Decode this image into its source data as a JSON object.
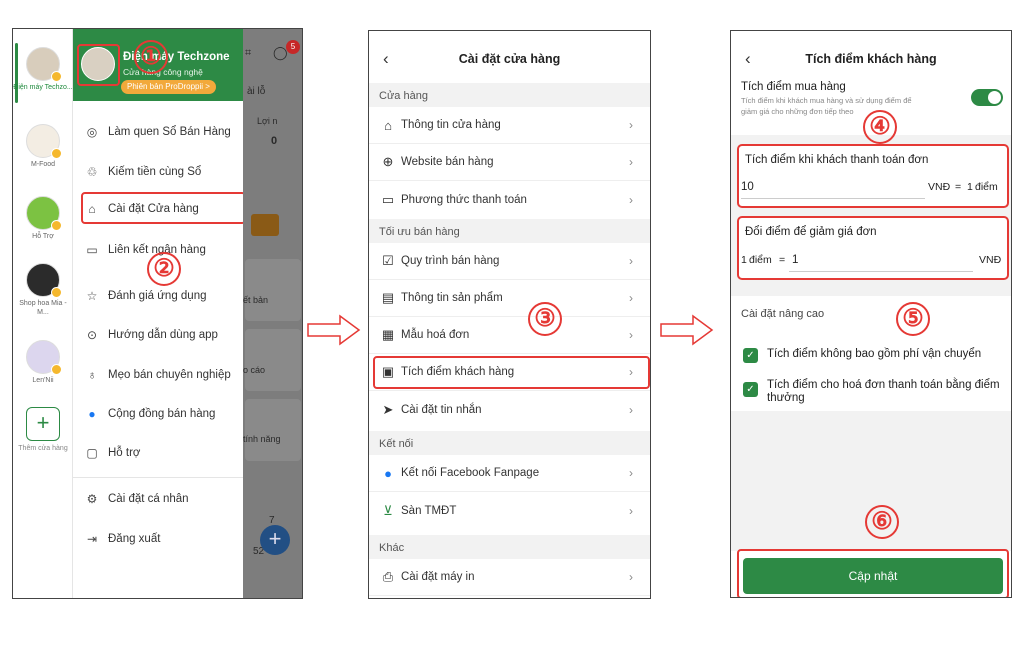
{
  "panel1": {
    "stores": [
      {
        "label": "Điện máy Techzo..."
      },
      {
        "label": "M-Food"
      },
      {
        "label": "Hỗ Trợ"
      },
      {
        "label": "Shop hoa Mia - M..."
      },
      {
        "label": "Len'Nii"
      }
    ],
    "add_store_label": "Thêm cửa hàng",
    "store_name": "Điện máy Techzone",
    "store_type": "Cửa hàng công nghệ",
    "version_badge": "Phiên bản ProDroppii >",
    "menu_items": [
      {
        "label": "Làm quen Sổ Bán Hàng",
        "icon": "target-icon"
      },
      {
        "label": "Kiếm tiền cùng Sổ",
        "icon": "handshake-icon"
      },
      {
        "label": "Cài đặt Cửa hàng",
        "icon": "store-icon"
      },
      {
        "label": "Liên kết ngân hàng",
        "icon": "card-icon"
      },
      {
        "label": "Đánh giá ứng dụng",
        "icon": "star-icon"
      },
      {
        "label": "Hướng dẫn dùng app",
        "icon": "play-icon"
      },
      {
        "label": "Mẹo bán chuyên nghiệp",
        "icon": "bulb-icon"
      },
      {
        "label": "Cộng đồng bán hàng",
        "icon": "facebook-icon"
      },
      {
        "label": "Hỗ trợ",
        "icon": "chat-icon"
      },
      {
        "label": "Cài đặt cá nhân",
        "icon": "gear-icon"
      },
      {
        "label": "Đăng xuất",
        "icon": "logout-icon"
      }
    ],
    "background": {
      "badge": "5",
      "tab_fragment": "ài lỗ",
      "loi_fragment": "Lợi n",
      "zero": "0",
      "tile1": "ết bản",
      "tile2": "o cáo",
      "tile3": "tính năng",
      "num1": "7",
      "num2": "52"
    }
  },
  "panel2": {
    "title": "Cài đặt cửa hàng",
    "sections": [
      {
        "header": "Cửa hàng",
        "items": [
          {
            "label": "Thông tin cửa hàng",
            "icon": "store-icon"
          },
          {
            "label": "Website bán hàng",
            "icon": "globe-icon"
          },
          {
            "label": "Phương thức thanh toán",
            "icon": "card-icon"
          }
        ]
      },
      {
        "header": "Tối ưu bán hàng",
        "items": [
          {
            "label": "Quy trình bán hàng",
            "icon": "checklist-icon"
          },
          {
            "label": "Thông tin sản phẩm",
            "icon": "box-icon"
          },
          {
            "label": "Mẫu hoá đơn",
            "icon": "receipt-icon"
          },
          {
            "label": "Tích điểm khách hàng",
            "icon": "points-icon"
          },
          {
            "label": "Cài đặt tin nhắn",
            "icon": "send-icon"
          }
        ]
      },
      {
        "header": "Kết nối",
        "items": [
          {
            "label": "Kết nối Facebook Fanpage",
            "icon": "facebook-icon"
          },
          {
            "label": "Sàn TMĐT",
            "icon": "cart-icon"
          }
        ]
      },
      {
        "header": "Khác",
        "items": [
          {
            "label": "Cài đặt máy in",
            "icon": "printer-icon"
          }
        ]
      }
    ]
  },
  "panel3": {
    "title": "Tích điểm khách hàng",
    "toggle_title": "Tích điểm mua hàng",
    "toggle_desc": "Tích điểm khi khách mua hàng và sử dụng điểm để giảm giá cho những đơn tiếp theo",
    "toggle_on": true,
    "earn": {
      "title": "Tích điểm khi khách thanh toán đơn",
      "amount": "10",
      "currency": "VNĐ",
      "equals": "=",
      "points_num": "1",
      "points_word": "điểm"
    },
    "redeem": {
      "title": "Đổi điểm để giảm giá đơn",
      "points_num": "1",
      "points_word": "điểm",
      "equals": "=",
      "amount": "1",
      "currency": "VNĐ"
    },
    "advanced_title": "Cài đặt nâng cao",
    "checkboxes": [
      {
        "label": "Tích điểm không bao gồm phí vận chuyển",
        "checked": true
      },
      {
        "label": "Tích điểm cho hoá đơn thanh toán bằng điểm thưởng",
        "checked": true
      }
    ],
    "update_button": "Cập nhật"
  },
  "steps": [
    "①",
    "②",
    "③",
    "④",
    "⑤",
    "⑥"
  ],
  "colors": {
    "brand_green": "#2d8a45",
    "highlight_red": "#e53935",
    "pro_orange": "#f2a93b"
  }
}
